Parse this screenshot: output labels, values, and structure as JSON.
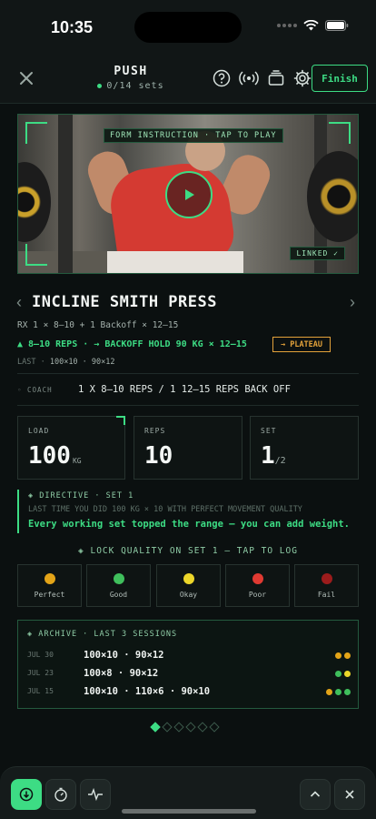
{
  "status_bar": {
    "time": "10:35"
  },
  "header": {
    "title": "PUSH",
    "subtitle": "0/14 sets",
    "finish_label": "Finish"
  },
  "video": {
    "top_label": "FORM INSTRUCTION · TAP TO PLAY",
    "linked_label": "LINKED ✓"
  },
  "exercise": {
    "name": "INCLINE SMITH PRESS",
    "rx": "RX 1 × 8–10 + 1 Backoff × 12–15",
    "progression": "▲ 8–10 REPS · → BACKOFF HOLD 90 KG × 12–15",
    "plateau_label": "→ PLATEAU",
    "last_label": "LAST ·",
    "last_values": "100×10 · 90×12",
    "coach_label": "◦ COACH",
    "coach_text": "1 X 8–10 REPS / 1 12–15 REPS BACK OFF"
  },
  "stats": {
    "load": {
      "label": "LOAD",
      "value": "100",
      "unit": "KG"
    },
    "reps": {
      "label": "REPS",
      "value": "10"
    },
    "set": {
      "label": "SET",
      "value": "1",
      "total": "/2"
    }
  },
  "directive": {
    "label": "◈ DIRECTIVE · SET 1",
    "sub": "LAST TIME YOU DID 100 KG × 10 WITH PERFECT MOVEMENT QUALITY",
    "main": "Every working set topped the range — you can add weight."
  },
  "lock_prompt": "◈ LOCK QUALITY ON SET 1 — TAP TO LOG",
  "ratings": [
    {
      "label": "Perfect",
      "color": "#e3a418"
    },
    {
      "label": "Good",
      "color": "#3fbf5c"
    },
    {
      "label": "Okay",
      "color": "#ecd62a"
    },
    {
      "label": "Poor",
      "color": "#e03a32"
    },
    {
      "label": "Fail",
      "color": "#9c1c1c"
    }
  ],
  "archive": {
    "title": "◈ ARCHIVE · LAST 3 SESSIONS",
    "rows": [
      {
        "date": "JUL 30",
        "values": "100×10 · 90×12",
        "dots": [
          "#e3a418",
          "#e3a418"
        ]
      },
      {
        "date": "JUL 23",
        "values": "100×8 · 90×12",
        "dots": [
          "#3fbf5c",
          "#ecd62a"
        ]
      },
      {
        "date": "JUL 15",
        "values": "100×10 · 110×6 · 90×10",
        "dots": [
          "#e3a418",
          "#3fbf5c",
          "#3fbf5c"
        ]
      }
    ]
  },
  "colors": {
    "accent": "#3ddc84",
    "warning": "#e3a23a",
    "background": "#0b1010"
  }
}
